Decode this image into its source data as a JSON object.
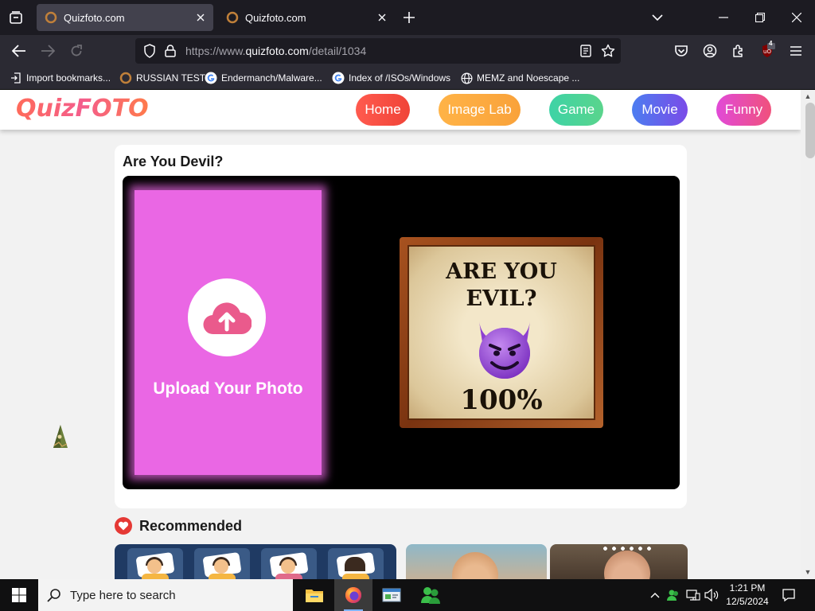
{
  "browser": {
    "tabs": [
      {
        "title": "Quizfoto.com",
        "active": true
      },
      {
        "title": "Quizfoto.com",
        "active": false
      }
    ],
    "url": {
      "prefix": "https://www.",
      "host": "quizfoto.com",
      "path": "/detail/1034"
    },
    "extension_badge": "4",
    "bookmarks": [
      {
        "label": "Import bookmarks...",
        "icon": "import-icon"
      },
      {
        "label": "RUSSIAN TEST",
        "icon": "quizfoto-favicon"
      },
      {
        "label": "Endermanch/Malware...",
        "icon": "google-icon"
      },
      {
        "label": "Index of /ISOs/Windows",
        "icon": "google-icon"
      },
      {
        "label": "MEMZ and Noescape ...",
        "icon": "globe-icon"
      }
    ]
  },
  "site": {
    "logo": "QuizFOTO",
    "nav": [
      {
        "label": "Home",
        "color_from": "#ff5a4e",
        "color_to": "#f04438"
      },
      {
        "label": "Image Lab",
        "color_from": "#ffb347",
        "color_to": "#f9a23a"
      },
      {
        "label": "Game",
        "color_from": "#3ed3a6",
        "color_to": "#5ad48c"
      },
      {
        "label": "Movie",
        "color_from": "#4c7df0",
        "color_to": "#7a4be8"
      },
      {
        "label": "Funny",
        "color_from": "#e14ad8",
        "color_to": "#f0517c"
      }
    ]
  },
  "quiz": {
    "title": "Are You Devil?",
    "upload_label": "Upload Your Photo",
    "preview": {
      "line1": "ARE YOU",
      "line2": "EVIL?",
      "line3": "100%"
    }
  },
  "recommended": {
    "title": "Recommended"
  },
  "taskbar": {
    "search_placeholder": "Type here to search",
    "time": "1:21 PM",
    "date": "12/5/2024"
  },
  "colors": {
    "upload_zone": "#ea67e4",
    "upload_icon": "#ea5a8c",
    "heart": "#e53935"
  }
}
